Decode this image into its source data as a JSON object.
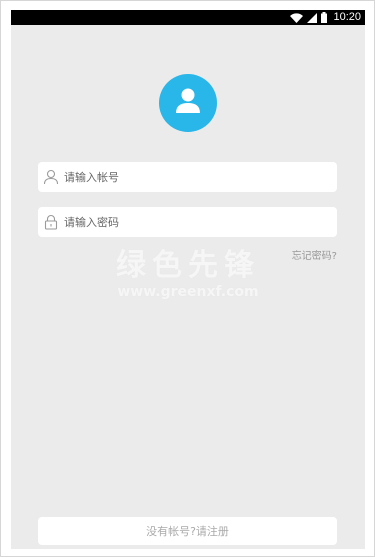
{
  "status_bar": {
    "time": "10:20",
    "icons": [
      "wifi-icon",
      "signal-icon",
      "battery-icon"
    ]
  },
  "avatar": {
    "icon": "user-icon",
    "color": "#29b6e8"
  },
  "login_form": {
    "account": {
      "icon": "user-outline-icon",
      "placeholder": "请输入帐号",
      "value": ""
    },
    "password": {
      "icon": "lock-icon",
      "placeholder": "请输入密码",
      "value": ""
    },
    "forgot_password_label": "忘记密码?"
  },
  "register_label": "没有帐号?请注册",
  "watermark": {
    "title": "绿色先锋",
    "url": "www.greenxf.com"
  },
  "colors": {
    "background": "#ebebeb",
    "field_background": "#ffffff",
    "accent": "#29b6e8",
    "muted_text": "#999999"
  }
}
